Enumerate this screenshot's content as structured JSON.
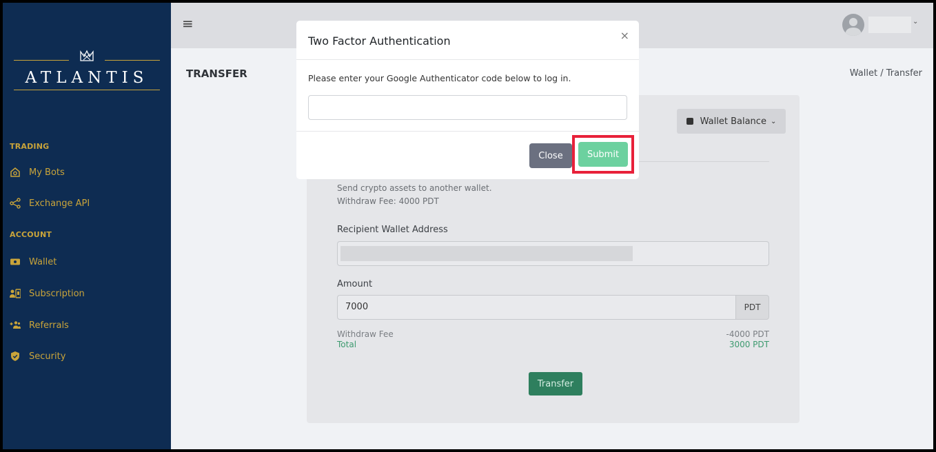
{
  "colors": {
    "sidebar_bg": "#0e2c52",
    "sidebar_accent": "#c9a43a",
    "success_green": "#2e7f5e",
    "submit_green": "#6cd19f",
    "highlight_red": "#e8213a",
    "close_gray": "#6b7080"
  },
  "sidebar": {
    "logo_text": "ATLANTIS",
    "sections": [
      {
        "title": "TRADING",
        "items": [
          {
            "label": "My Bots",
            "icon": "robot-icon"
          },
          {
            "label": "Exchange API",
            "icon": "share-nodes-icon"
          }
        ]
      },
      {
        "title": "ACCOUNT",
        "items": [
          {
            "label": "Wallet",
            "icon": "wallet-icon"
          },
          {
            "label": "Subscription",
            "icon": "subscription-icon"
          },
          {
            "label": "Referrals",
            "icon": "add-users-icon"
          },
          {
            "label": "Security",
            "icon": "shield-icon"
          }
        ]
      }
    ]
  },
  "header": {
    "menu_icon": "hamburger-icon",
    "user_caret": "⌄"
  },
  "page": {
    "title": "TRANSFER",
    "breadcrumb": "Wallet / Transfer"
  },
  "card": {
    "wallet_balance_label": "Wallet Balance",
    "wallet_caret": "⌄",
    "description": "Send crypto assets to another wallet.",
    "withdraw_fee_note": "Withdraw Fee: 4000 PDT",
    "recipient_label": "Recipient Wallet Address",
    "amount_label": "Amount",
    "amount_value": "7000",
    "amount_unit": "PDT",
    "fee_label": "Withdraw Fee",
    "fee_value": "-4000 PDT",
    "total_label": "Total",
    "total_value": "3000 PDT",
    "transfer_button": "Transfer"
  },
  "modal": {
    "title": "Two Factor Authentication",
    "close_symbol": "×",
    "message": "Please enter your Google Authenticator code below to log in.",
    "code_value": "",
    "close_button": "Close",
    "submit_button": "Submit"
  }
}
